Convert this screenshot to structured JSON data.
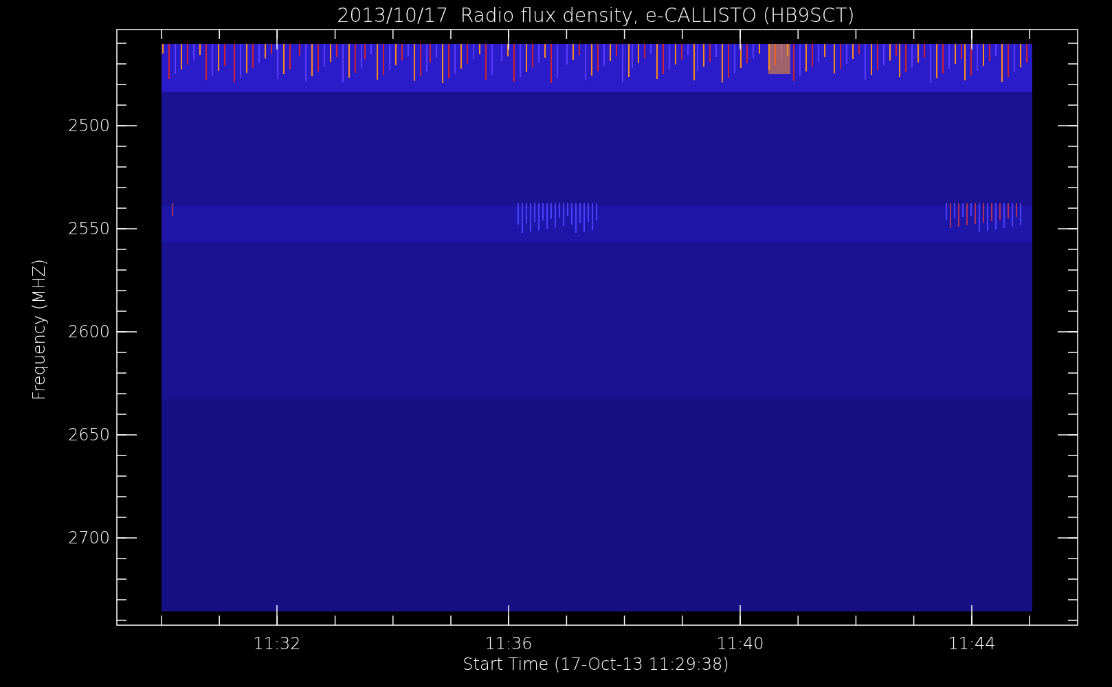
{
  "title": "2013/10/17  Radio flux density, e-CALLISTO (HB9SCT)",
  "y_axis": {
    "label": "Frequency (MHZ)",
    "ticks": [
      "2500",
      "2550",
      "2600",
      "2650",
      "2700"
    ]
  },
  "x_axis": {
    "label": "Start Time (17-Oct-13 11:29:38)",
    "ticks": [
      "11:32",
      "11:36",
      "11:40",
      "11:44"
    ]
  }
}
